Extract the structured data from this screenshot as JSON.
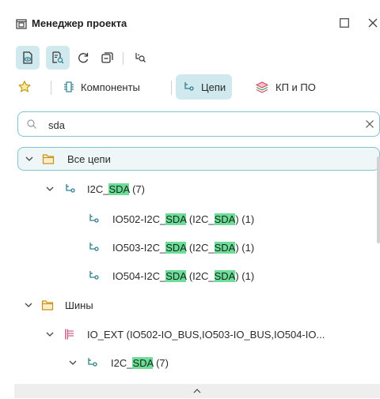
{
  "window": {
    "title": "Менеджер проекта"
  },
  "tabs": [
    {
      "label": "Компоненты"
    },
    {
      "label": "Цепи"
    },
    {
      "label": "КП и ПО"
    }
  ],
  "search": {
    "value": "sda"
  },
  "tree": {
    "all_nets": "Все цепи",
    "net": {
      "prefix": "I2C_",
      "match": "SDA",
      "suffix": " (7)"
    },
    "children": [
      {
        "prefix": "IO502-I2C_",
        "match1": "SDA",
        "mid": " (I2C_",
        "match2": "SDA",
        "suffix": ") (1)"
      },
      {
        "prefix": "IO503-I2C_",
        "match1": "SDA",
        "mid": " (I2C_",
        "match2": "SDA",
        "suffix": ") (1)"
      },
      {
        "prefix": "IO504-I2C_",
        "match1": "SDA",
        "mid": " (I2C_",
        "match2": "SDA",
        "suffix": ") (1)"
      }
    ],
    "buses": "Шины",
    "bus": "IO_EXT (IO502-IO_BUS,IO503-IO_BUS,IO504-IO...",
    "bus_net": {
      "prefix": "I2C_",
      "match": "SDA",
      "suffix": " (7)"
    }
  },
  "icons": {
    "accent": "#7fc4cf",
    "highlight": "#6fdb99",
    "folder": "#d9a53a"
  }
}
